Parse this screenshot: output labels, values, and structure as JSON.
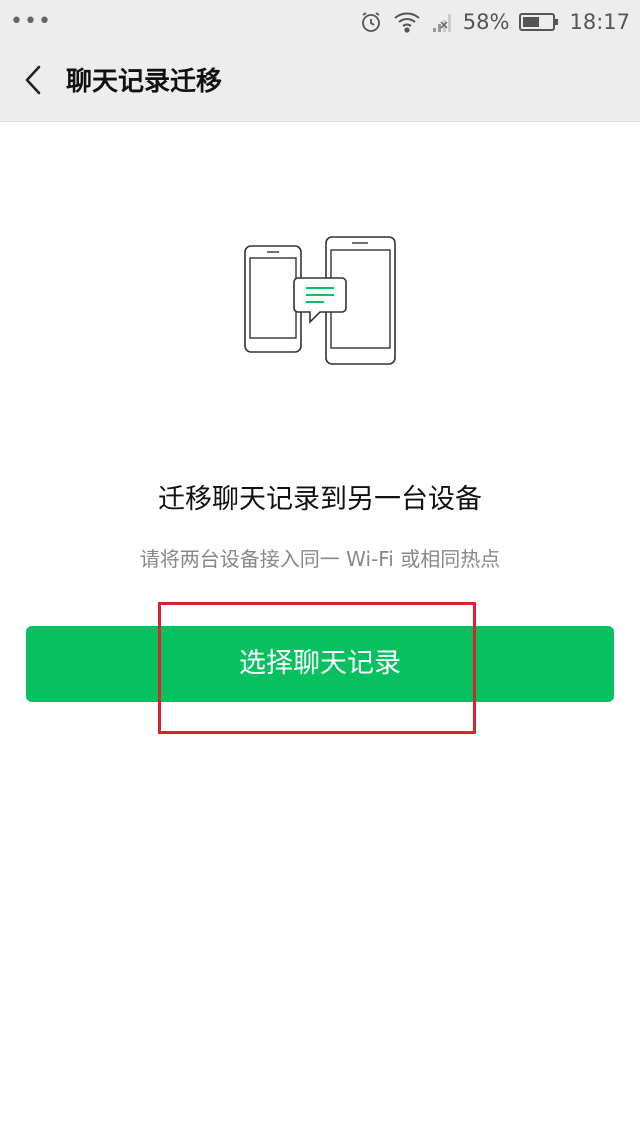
{
  "status_bar": {
    "menu_dots": "•••",
    "alarm_icon": "alarm-clock-icon",
    "wifi_icon": "wifi-icon",
    "signal_icon": "no-signal-icon",
    "battery_percent": "58%",
    "battery_icon": "battery-icon",
    "battery_level": 0.58,
    "time": "18:17"
  },
  "header": {
    "back_icon": "chevron-left-icon",
    "title": "聊天记录迁移"
  },
  "main": {
    "illustration_icon": "phone-transfer-icon",
    "headline": "迁移聊天记录到另一台设备",
    "subtext": "请将两台设备接入同一 Wi-Fi 或相同热点",
    "primary_button_label": "选择聊天记录"
  },
  "colors": {
    "brand_green": "#07c160",
    "header_bg": "#ededed",
    "highlight_red": "#d9232e"
  }
}
